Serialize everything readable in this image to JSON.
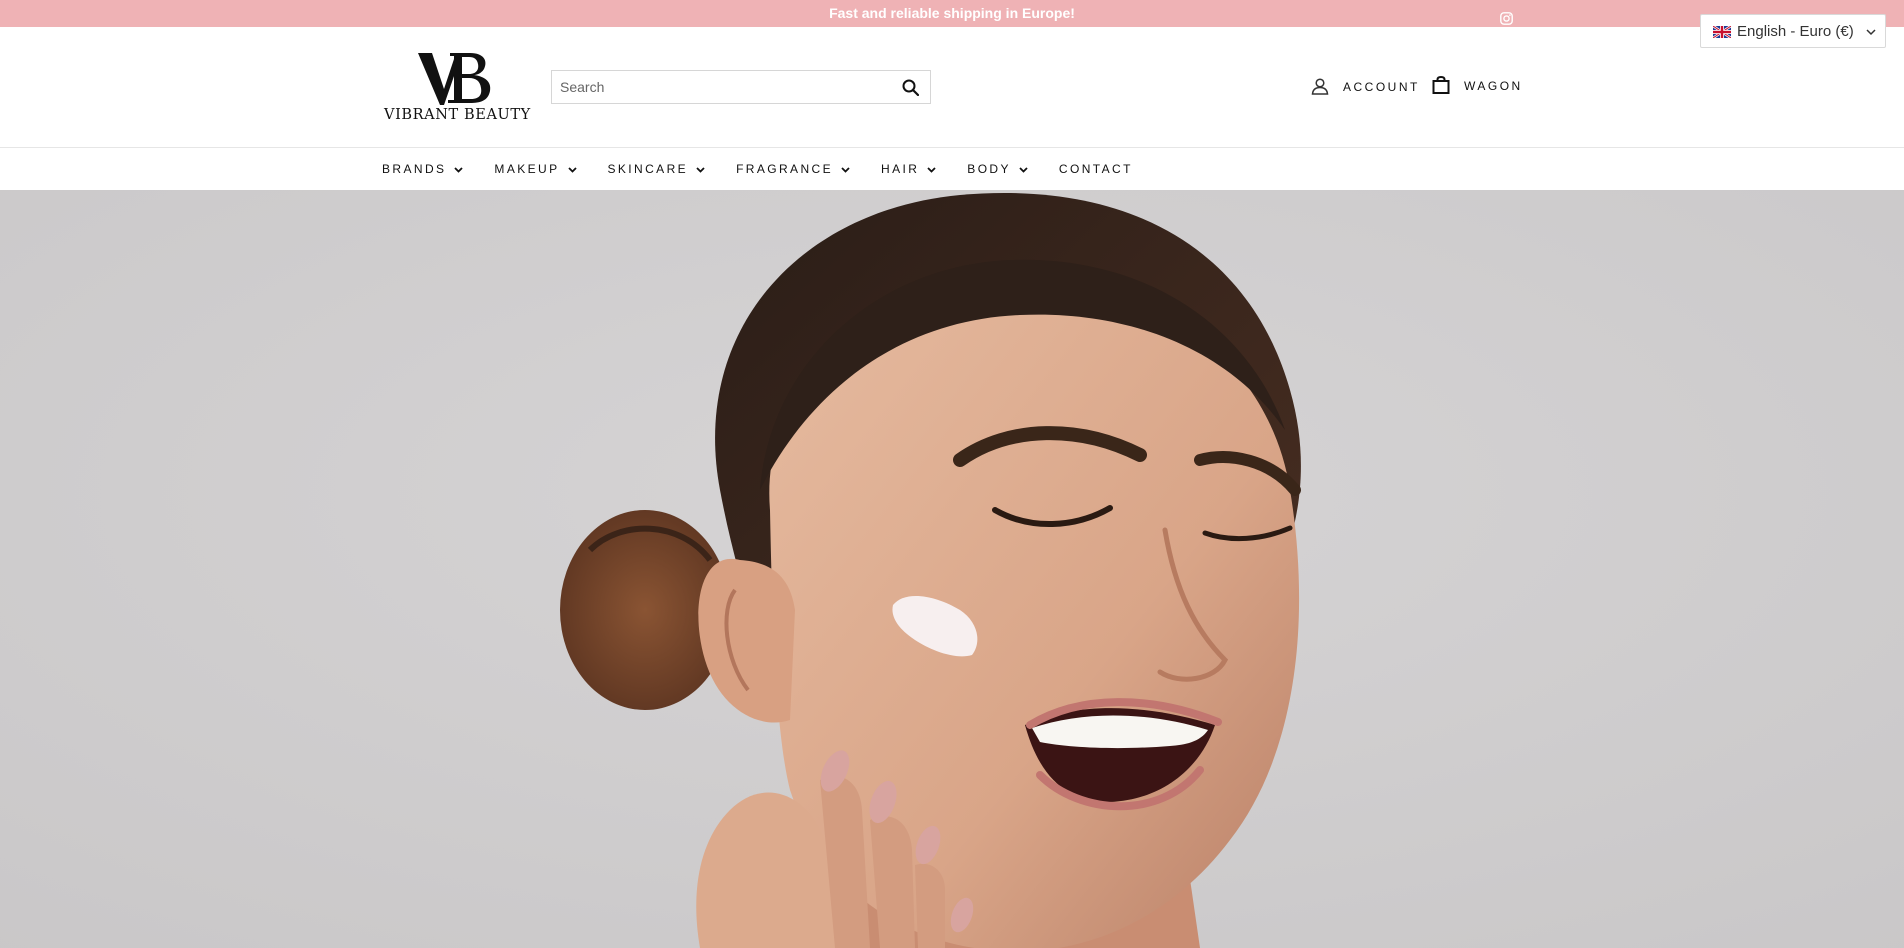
{
  "announcement": {
    "text": "Fast and reliable shipping in Europe!",
    "social_icon": "instagram-icon"
  },
  "language_selector": {
    "label": "English - Euro (€)",
    "flag": "uk-flag-icon"
  },
  "brand": {
    "monogram": "VB",
    "name": "VIBRANT BEAUTY"
  },
  "search": {
    "placeholder": "Search",
    "value": ""
  },
  "account": {
    "label": "ACCOUNT",
    "icon": "user-icon"
  },
  "cart": {
    "label": "WAGON",
    "icon": "bag-icon"
  },
  "nav": {
    "items": [
      {
        "label": "BRANDS",
        "has_dropdown": true
      },
      {
        "label": "MAKEUP",
        "has_dropdown": true
      },
      {
        "label": "SKINCARE",
        "has_dropdown": true
      },
      {
        "label": "FRAGRANCE",
        "has_dropdown": true
      },
      {
        "label": "HAIR",
        "has_dropdown": true
      },
      {
        "label": "BODY",
        "has_dropdown": true
      },
      {
        "label": "CONTACT",
        "has_dropdown": false
      }
    ]
  },
  "colors": {
    "announcement_bg": "#efb2b5",
    "hero_bg": "#cfcdce",
    "text": "#111111"
  }
}
